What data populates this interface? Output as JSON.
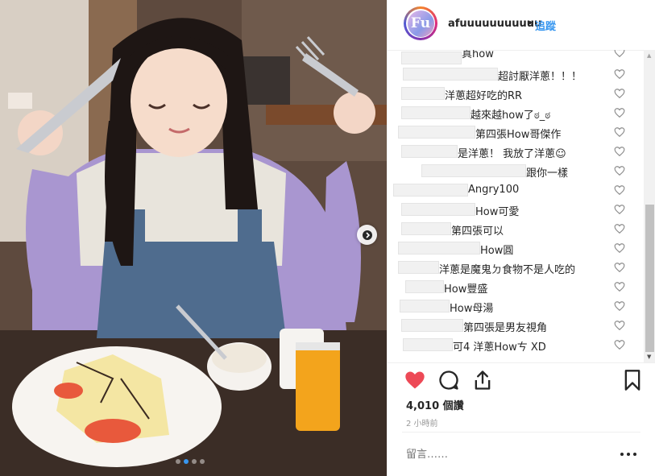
{
  "header": {
    "avatar_text": "Fu",
    "username": "afuuuuuuuuuuu",
    "separator": "•",
    "follow_label": "追蹤"
  },
  "comments": [
    {
      "text": "真how"
    },
    {
      "text": "超討厭洋蔥！！！"
    },
    {
      "text": "洋蔥超好吃的RR"
    },
    {
      "text": "越來越how了ಠ_ಠ"
    },
    {
      "text": "第四張How哥傑作"
    },
    {
      "text": "是洋蔥！ 我放了洋蔥☺"
    },
    {
      "text": "跟你一樣"
    },
    {
      "text": "Angry100"
    },
    {
      "text": "How可愛"
    },
    {
      "text": "第四張可以"
    },
    {
      "text": "How圓"
    },
    {
      "text": "洋蔥是魔鬼ㄉ食物不是人吃的"
    },
    {
      "text": "How豐盛"
    },
    {
      "text": "How母湯"
    },
    {
      "text": "第四張是男友視角"
    },
    {
      "text": "可4 洋蔥Howㄘ XD"
    }
  ],
  "post": {
    "likes": "4,010 個讚",
    "time": "2 小時前",
    "comment_placeholder": "留言……",
    "liked": true,
    "carousel_dots": 4,
    "carousel_active": 1
  },
  "colors": {
    "accent": "#3897f0",
    "like_red": "#ed4956",
    "text": "#262626",
    "muted": "#999999"
  },
  "icons": [
    "chevron-right-icon",
    "heart-icon",
    "comment-icon",
    "share-icon",
    "bookmark-icon",
    "more-icon"
  ]
}
